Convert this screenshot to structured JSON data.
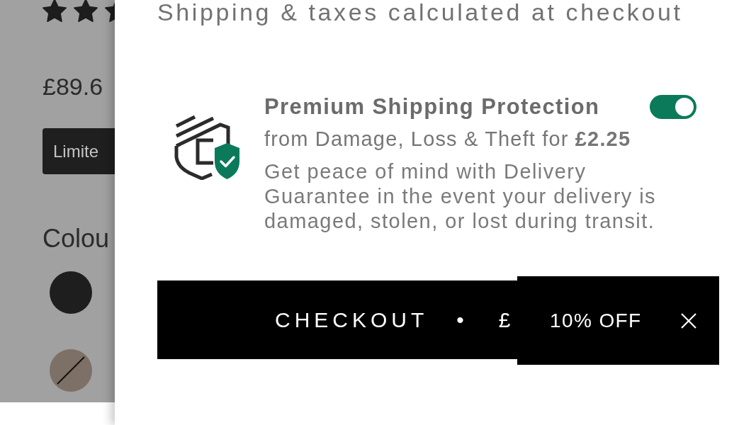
{
  "product_page": {
    "rating_stars": [
      {
        "filled": true
      },
      {
        "filled": true
      },
      {
        "filled": true
      }
    ],
    "price": "£89.6",
    "badge": "Limite",
    "colour_label": "Colou",
    "swatches": [
      {
        "color": "#1e1e1e",
        "unavailable": false
      },
      {
        "color": "#7d7066",
        "unavailable": true
      }
    ]
  },
  "cart_drawer": {
    "shipping_note": "Shipping & taxes calculated at checkout",
    "protection": {
      "title": "Premium Shipping Protection",
      "subtitle": "from Damage, Loss & Theft for **£2.25**",
      "description": "Get peace of mind with Delivery Guarantee in the event your delivery is damaged, stolen, or lost during transit.",
      "on": true
    },
    "checkout_button": {
      "label": "CHECKOUT",
      "separator": "•",
      "price": "£"
    }
  },
  "discount_teaser": {
    "label": "10% OFF"
  }
}
